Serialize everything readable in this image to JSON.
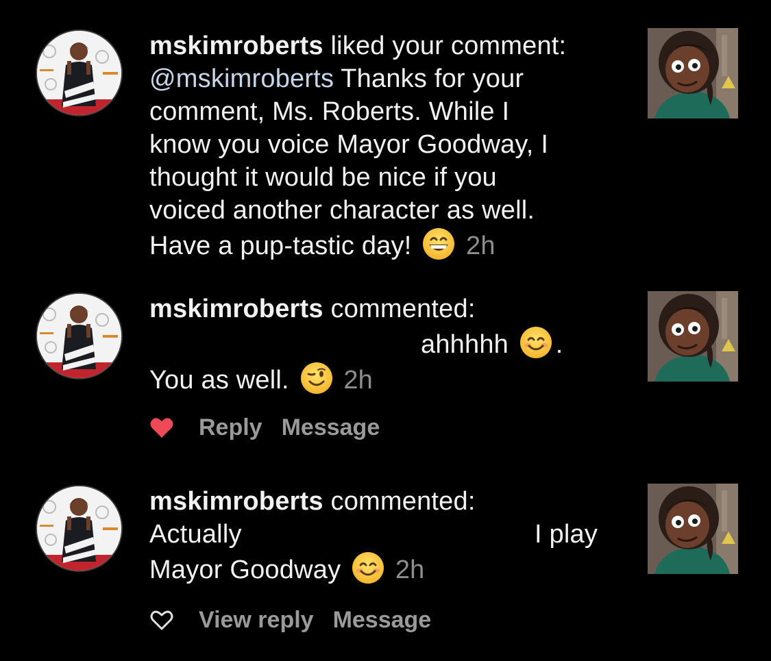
{
  "notifications": [
    {
      "username": "mskimroberts",
      "action": " liked your comment:",
      "mention": "@mskimroberts",
      "lines": [
        " Thanks for your",
        "comment, Ms. Roberts. While I",
        "know you voice Mayor Goodway, I",
        "thought it would be nice if you",
        "voiced another character as well.",
        "Have a pup-tastic day!"
      ],
      "emoji": "grinning-face",
      "time": "2h"
    },
    {
      "username": "mskimroberts",
      "action": " commented:",
      "line2": "ahhhhh",
      "line2_after": ".",
      "line3": "You as well.",
      "emoji_a": "smiling-face",
      "emoji_b": "winking-face",
      "time": "2h",
      "liked": true,
      "actions": [
        "Reply",
        "Message"
      ]
    },
    {
      "username": "mskimroberts",
      "action": " commented:",
      "line2_left": "Actually",
      "line2_right": "I play",
      "line3": "Mayor Goodway",
      "emoji": "smiling-face",
      "time": "2h",
      "liked": false,
      "actions": [
        "View reply",
        "Message"
      ]
    }
  ],
  "colors": {
    "background": "#000000",
    "text": "#f2f2f2",
    "mention": "#c7d6ea",
    "muted": "#8e8e8e",
    "heart": "#ed4956"
  }
}
